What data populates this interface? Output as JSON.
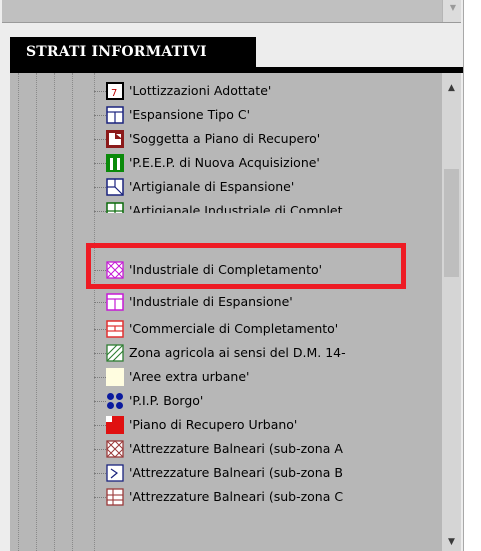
{
  "panel": {
    "tab_label": "STRATI INFORMATIVI"
  },
  "tree": {
    "items": [
      {
        "label": "'Lottizzazioni Adottate'",
        "icon": "lottizzazioni-icon"
      },
      {
        "label": "'Espansione Tipo C'",
        "icon": "espansione-c-icon"
      },
      {
        "label": "'Soggetta a Piano di Recupero'",
        "icon": "piano-recupero-icon"
      },
      {
        "label": "'P.E.E.P. di Nuova Acquisizione'",
        "icon": "peep-icon"
      },
      {
        "label": "'Artigianale di Espansione'",
        "icon": "artigianale-espansione-icon"
      },
      {
        "label": "'Artigianale Industriale di Complet",
        "icon": "artigianale-industriale-icon"
      },
      {
        "label": "'Industriale di Completamento'",
        "icon": "industriale-completamento-icon"
      },
      {
        "label": "'Industriale di Espansione'",
        "icon": "industriale-espansione-icon"
      },
      {
        "label": "'Commerciale di Completamento'",
        "icon": "commerciale-icon"
      },
      {
        "label": "Zona agricola ai sensi del D.M. 14-",
        "icon": "zona-agricola-icon"
      },
      {
        "label": "'Aree extra urbane'",
        "icon": "aree-extra-icon"
      },
      {
        "label": "'P.I.P. Borgo'",
        "icon": "pip-borgo-icon"
      },
      {
        "label": "'Piano di Recupero Urbano'",
        "icon": "recupero-urbano-icon"
      },
      {
        "label": "'Attrezzature Balneari (sub-zona A",
        "icon": "balneari-a-icon"
      },
      {
        "label": "'Attrezzature Balneari (sub-zona B",
        "icon": "balneari-b-icon"
      },
      {
        "label": "'Attrezzature Balneari (sub-zona C",
        "icon": "balneari-c-icon"
      }
    ]
  },
  "colors": {
    "highlight": "#ee1b24",
    "tree_background": "#b7b7b7",
    "tab_background": "#000000"
  }
}
